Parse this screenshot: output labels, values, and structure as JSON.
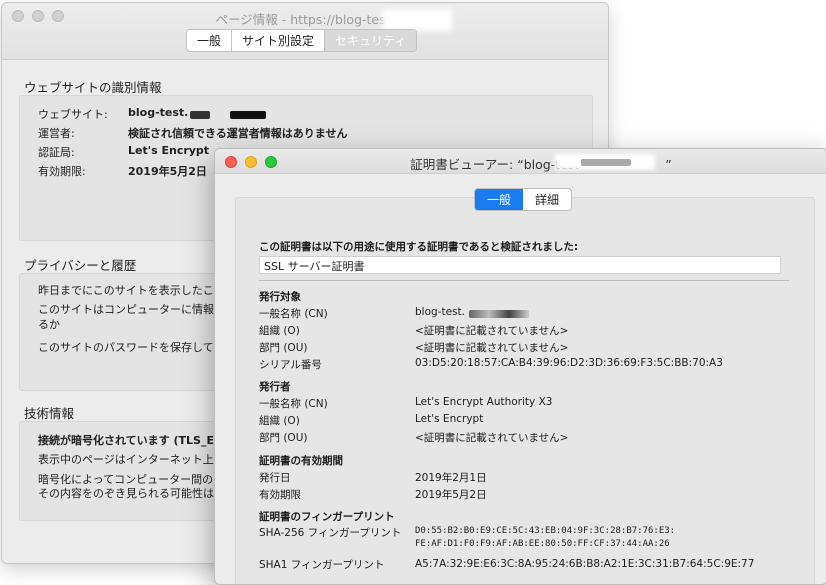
{
  "bg_window": {
    "title": "ページ情報 - https://blog-test.",
    "tabs": [
      "一般",
      "サイト別設定",
      "セキュリティ"
    ],
    "identity": {
      "heading": "ウェブサイトの識別情報",
      "rows": [
        {
          "label": "ウェブサイト:",
          "value": "blog-test."
        },
        {
          "label": "運営者:",
          "value": "検証され信頼できる運営者情報はありません"
        },
        {
          "label": "認証局:",
          "value": "Let's Encrypt"
        },
        {
          "label": "有効期限:",
          "value": "2019年5月2日"
        }
      ]
    },
    "privacy": {
      "heading": "プライバシーと履歴",
      "lines": [
        "昨日までにこのサイトを表示したこ",
        "このサイトはコンピューターに情報",
        "るか",
        "このサイトのパスワードを保存して"
      ]
    },
    "tech": {
      "heading": "技術情報",
      "lines": [
        "接続が暗号化されています (TLS_EC",
        "表示中のページはインターネット上",
        "暗号化によってコンピューター間の",
        "その内容をのぞき見られる可能性は"
      ]
    }
  },
  "cert_window": {
    "title": "証明書ビューアー: “blog-test",
    "title_end": "”",
    "tabs": [
      "一般",
      "詳細"
    ],
    "verified_text": "この証明書は以下の用途に使用する証明書であると検証されました:",
    "usage": "SSL サーバー証明書",
    "subject": {
      "heading": "発行対象",
      "rows": [
        {
          "label": "一般名称 (CN)",
          "value": "blog-test."
        },
        {
          "label": "組織 (O)",
          "value": "<証明書に記載されていません>"
        },
        {
          "label": "部門 (OU)",
          "value": "<証明書に記載されていません>"
        },
        {
          "label": "シリアル番号",
          "value": "03:D5:20:18:57:CA:B4:39:96:D2:3D:36:69:F3:5C:BB:70:A3"
        }
      ]
    },
    "issuer": {
      "heading": "発行者",
      "rows": [
        {
          "label": "一般名称 (CN)",
          "value": "Let's Encrypt Authority X3"
        },
        {
          "label": "組織 (O)",
          "value": "Let's Encrypt"
        },
        {
          "label": "部門 (OU)",
          "value": "<証明書に記載されていません>"
        }
      ]
    },
    "validity": {
      "heading": "証明書の有効期間",
      "rows": [
        {
          "label": "発行日",
          "value": "2019年2月1日"
        },
        {
          "label": "有効期限",
          "value": "2019年5月2日"
        }
      ]
    },
    "fingerprints": {
      "heading": "証明書のフィンガープリント",
      "sha256_label": "SHA-256 フィンガープリント",
      "sha256_line1": "D0:55:B2:B0:E9:CE:5C:43:EB:04:9F:3C:28:B7:76:E3:",
      "sha256_line2": "FE:AF:D1:F0:F9:AF:AB:EE:80:50:FF:CF:37:44:AA:26",
      "sha1_label": "SHA1 フィンガープリント",
      "sha1_value": "A5:7A:32:9E:E6:3C:8A:95:24:6B:B8:A2:1E:3C:31:B7:64:5C:9E:77"
    }
  }
}
